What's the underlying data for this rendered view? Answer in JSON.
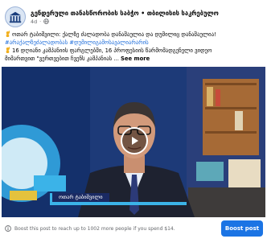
{
  "post": {
    "page_name": "გენდერული თანასწორობის საბჭო • თბილისის საკრებულო",
    "time": "4d",
    "privacy_icon": "globe-icon",
    "avatar_icon": "parliament-emblem-icon",
    "caption": {
      "line1": "ოთარ ტაბიშვილი: ქალზე ძალადობა დანაშაულია და დუმილიც დანაშაულია!",
      "line2_hashtags": "#არაქალზეძალადობას #დუმილიგამოსავალიარარის",
      "line3": "16 დღიანი კამპანიის ფარგლებში, 16 პროფესიის წარმომადგენელი ვიდეო",
      "line4": "მიმართვით \"ვერთვებით ჩვენს კამპანიას ...",
      "see_more": "See more",
      "emoji_icon": "person-raising-hand-icon"
    },
    "video": {
      "play_icon": "play-icon",
      "lower_third_name": "ოთარ ტაბიშვილი"
    }
  },
  "footer": {
    "boost_text": "Boost this post to reach up to 1002 more people if you spend $14.",
    "info_icon": "info-icon",
    "boost_button": "Boost post"
  },
  "colors": {
    "accent": "#1b74e4",
    "hashtag": "#216fdb",
    "muted_text": "#65676b",
    "video_navy": "#1a2a63",
    "video_cyan": "#3bb3e8"
  }
}
